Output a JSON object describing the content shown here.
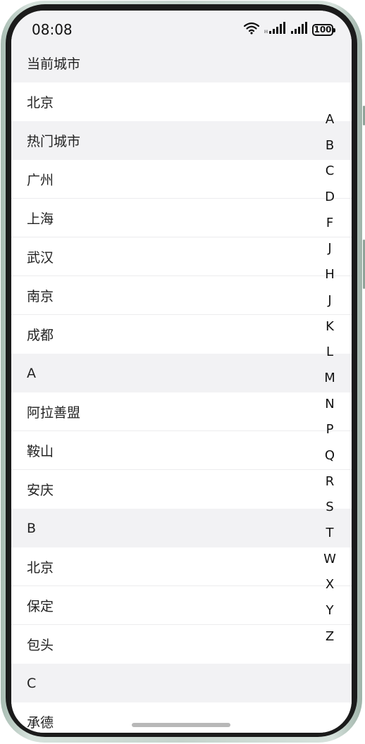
{
  "status_bar": {
    "time": "08:08",
    "battery": "100",
    "icons": [
      "wifi-icon",
      "signal-icon",
      "signal-icon",
      "battery-icon"
    ]
  },
  "list": {
    "sections": [
      {
        "header": "当前城市",
        "items": [
          "北京"
        ]
      },
      {
        "header": "热门城市",
        "items": [
          "广州",
          "上海",
          "武汉",
          "南京",
          "成都"
        ]
      },
      {
        "header": "A",
        "items": [
          "阿拉善盟",
          "鞍山",
          "安庆"
        ]
      },
      {
        "header": "B",
        "items": [
          "北京",
          "保定",
          "包头"
        ]
      },
      {
        "header": "C",
        "items": [
          "承德"
        ]
      }
    ]
  },
  "index_bar": {
    "letters": [
      "A",
      "B",
      "C",
      "D",
      "F",
      "J",
      "H",
      "J",
      "K",
      "L",
      "M",
      "N",
      "P",
      "Q",
      "R",
      "S",
      "T",
      "W",
      "X",
      "Y",
      "Z"
    ]
  }
}
